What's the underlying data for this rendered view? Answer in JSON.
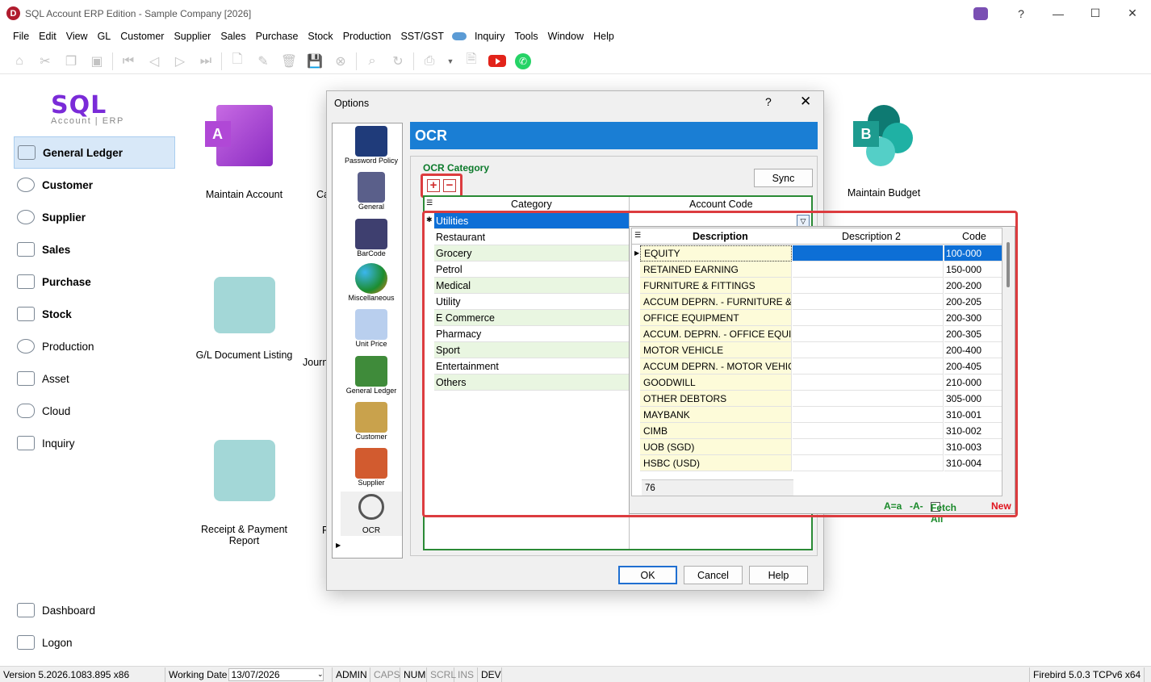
{
  "window": {
    "title": "SQL Account ERP Edition - Sample Company [2026]",
    "help_label": "?",
    "controls": [
      "—",
      "☐",
      "✕"
    ]
  },
  "menu": [
    "File",
    "Edit",
    "View",
    "GL",
    "Customer",
    "Supplier",
    "Sales",
    "Purchase",
    "Stock",
    "Production",
    "SST/GST",
    "Inquiry",
    "Tools",
    "Window",
    "Help"
  ],
  "logo": {
    "main": "SQL",
    "sub": "Account | ERP"
  },
  "sidebar": {
    "items": [
      "General Ledger",
      "Customer",
      "Supplier",
      "Sales",
      "Purchase",
      "Stock",
      "Production",
      "Asset",
      "Cloud",
      "Inquiry"
    ],
    "bottom": [
      "Dashboard",
      "Logon"
    ]
  },
  "tiles": {
    "maintain_account": "Maintain Account",
    "maintain_account_badge": "A",
    "gl_doc_listing": "G/L Document Listing",
    "receipt_report_1": "Receipt & Payment",
    "receipt_report_2": "Report",
    "maintain_budget": "Maintain Budget",
    "maintain_budget_badge": "B",
    "partial_ca": "Ca",
    "partial_journ": "Journ",
    "partial_r": "R"
  },
  "statusbar": {
    "version": "Version 5.2026.1083.895 x86",
    "working_date_label": "Working Date",
    "working_date": "13/07/2026",
    "admin": "ADMIN",
    "caps": "CAPS",
    "num": "NUM",
    "scrl": "SCRL",
    "ins": "INS",
    "dev": "DEV",
    "db": "Firebird 5.0.3 TCPv6 x64"
  },
  "dialog": {
    "title": "Options",
    "help": "?",
    "close": "✕",
    "side_items": [
      "Password Policy",
      "General",
      "BarCode",
      "Miscellaneous",
      "Unit Price",
      "General Ledger",
      "Customer",
      "Supplier",
      "OCR"
    ],
    "header": "OCR",
    "group_label": "OCR Category",
    "sync_label": "Sync",
    "plus": "+",
    "minus": "−",
    "col_category": "Category",
    "col_account_code": "Account Code",
    "categories": [
      "Utilities",
      "Restaurant",
      "Grocery",
      "Petrol",
      "Medical",
      "Utility",
      "E Commerce",
      "Pharmacy",
      "Sport",
      "Entertainment",
      "Others"
    ],
    "ok": "OK",
    "cancel": "Cancel",
    "help_btn": "Help"
  },
  "lookup": {
    "col_description": "Description",
    "col_description2": "Description 2",
    "col_code": "Code",
    "rows": [
      {
        "desc": "EQUITY",
        "code": "100-000"
      },
      {
        "desc": "RETAINED EARNING",
        "code": "150-000"
      },
      {
        "desc": "FURNITURE & FITTINGS",
        "code": "200-200"
      },
      {
        "desc": "ACCUM DEPRN. - FURNITURE & FI",
        "code": "200-205"
      },
      {
        "desc": "OFFICE EQUIPMENT",
        "code": "200-300"
      },
      {
        "desc": "ACCUM. DEPRN. - OFFICE EQUIPM",
        "code": "200-305"
      },
      {
        "desc": "MOTOR VEHICLE",
        "code": "200-400"
      },
      {
        "desc": "ACCUM DEPRN. - MOTOR VEHICL",
        "code": "200-405"
      },
      {
        "desc": "GOODWILL",
        "code": "210-000"
      },
      {
        "desc": "OTHER DEBTORS",
        "code": "305-000"
      },
      {
        "desc": "MAYBANK",
        "code": "310-001"
      },
      {
        "desc": "CIMB",
        "code": "310-002"
      },
      {
        "desc": "UOB (SGD)",
        "code": "310-003"
      },
      {
        "desc": "HSBC (USD)",
        "code": "310-004"
      }
    ],
    "record_count": "76",
    "case_label": "A=a",
    "filter_label": "-A-",
    "fetch_all": "Fetch All",
    "new_label": "New"
  }
}
